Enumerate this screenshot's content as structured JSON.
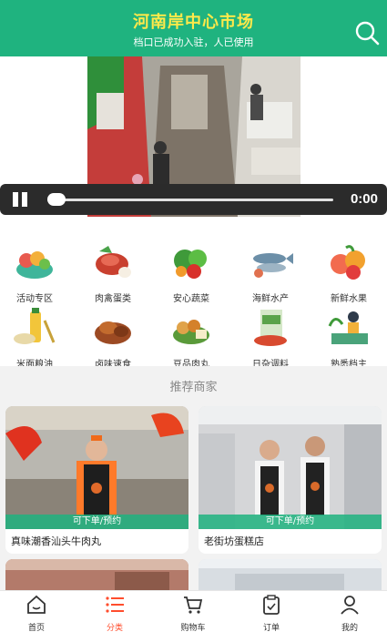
{
  "header": {
    "title": "河南岸中心市场",
    "subtitle": "档口已成功入驻，人已使用"
  },
  "video": {
    "time": "0:00",
    "progress": 0.0
  },
  "categories": [
    {
      "label": "活动专区",
      "icon": "activity-zone-icon"
    },
    {
      "label": "肉禽蛋类",
      "icon": "meat-poultry-eggs-icon"
    },
    {
      "label": "安心蔬菜",
      "icon": "vegetables-icon"
    },
    {
      "label": "海鲜水产",
      "icon": "seafood-icon"
    },
    {
      "label": "新鲜水果",
      "icon": "fruit-icon"
    },
    {
      "label": "米面粮油",
      "icon": "grain-oil-icon"
    },
    {
      "label": "卤味速食",
      "icon": "braised-food-icon"
    },
    {
      "label": "豆品肉丸",
      "icon": "tofu-meatball-icon"
    },
    {
      "label": "日杂调料",
      "icon": "seasoning-icon"
    },
    {
      "label": "熟悉档主",
      "icon": "vendor-icon"
    }
  ],
  "merchants": {
    "section_title": "推荐商家",
    "ribbon_label": "可下单/预约",
    "items": [
      {
        "name": "真味潮香汕头牛肉丸"
      },
      {
        "name": "老街坊蛋糕店"
      }
    ]
  },
  "tabbar": {
    "active_color": "#ff4d2d",
    "items": [
      {
        "label": "首页",
        "icon": "home-icon"
      },
      {
        "label": "分类",
        "icon": "category-list-icon"
      },
      {
        "label": "购物车",
        "icon": "cart-icon"
      },
      {
        "label": "订单",
        "icon": "order-icon"
      },
      {
        "label": "我的",
        "icon": "profile-icon"
      }
    ]
  },
  "colors": {
    "brand": "#1fb37f",
    "title": "#ffe94a"
  }
}
